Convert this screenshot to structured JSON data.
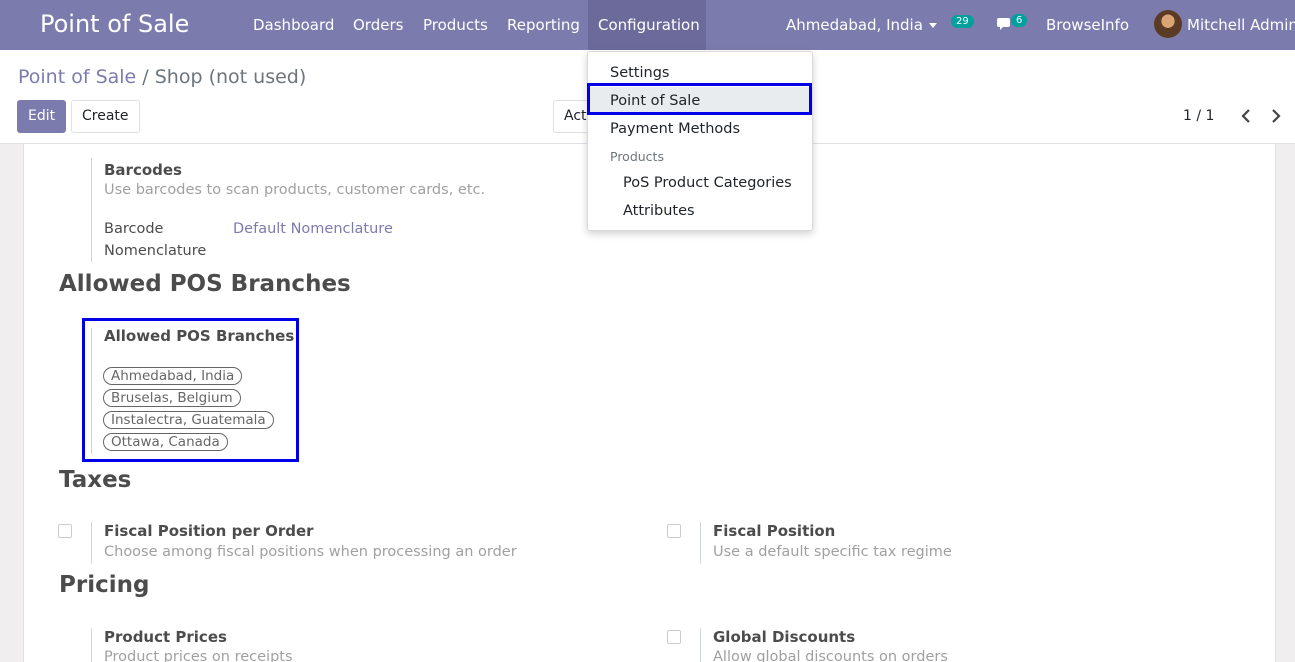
{
  "navbar": {
    "app_title": "Point of Sale",
    "menu": [
      "Dashboard",
      "Orders",
      "Products",
      "Reporting",
      "Configuration"
    ],
    "branch_selector": "Ahmedabad, India",
    "activity_count": "29",
    "message_count": "6",
    "company": "BrowseInfo",
    "user": "Mitchell Admin"
  },
  "control_panel": {
    "breadcrumb_parent": "Point of Sale",
    "breadcrumb_sep": "/",
    "breadcrumb_current": "Shop (not used)",
    "edit_label": "Edit",
    "create_label": "Create",
    "action_label": "Action",
    "pager": "1 / 1"
  },
  "dropdown": {
    "items": [
      "Settings",
      "Point of Sale",
      "Payment Methods"
    ],
    "products_header": "Products",
    "sub_items": [
      "PoS Product Categories",
      "Attributes"
    ]
  },
  "sheet": {
    "barcodes": {
      "title": "Barcodes",
      "desc": "Use barcodes to scan products, customer cards, etc.",
      "nomenclature_label_1": "Barcode",
      "nomenclature_label_2": "Nomenclature",
      "nomenclature_value": "Default Nomenclature"
    },
    "branches_section": "Allowed POS Branches",
    "branches_field": "Allowed POS Branches",
    "branches": [
      "Ahmedabad, India",
      "Bruselas, Belgium",
      "Instalectra, Guatemala",
      "Ottawa, Canada"
    ],
    "taxes_section": "Taxes",
    "fiscal_per_order_title": "Fiscal Position per Order",
    "fiscal_per_order_desc": "Choose among fiscal positions when processing an order",
    "fiscal_position_title": "Fiscal Position",
    "fiscal_position_desc": "Use a default specific tax regime",
    "pricing_section": "Pricing",
    "product_prices_title": "Product Prices",
    "product_prices_desc": "Product prices on receipts",
    "global_discounts_title": "Global Discounts",
    "global_discounts_desc": "Allow global discounts on orders"
  },
  "colors": {
    "brand": "#7c7bad",
    "highlight": "#0000e8",
    "badge": "#00a09d"
  }
}
